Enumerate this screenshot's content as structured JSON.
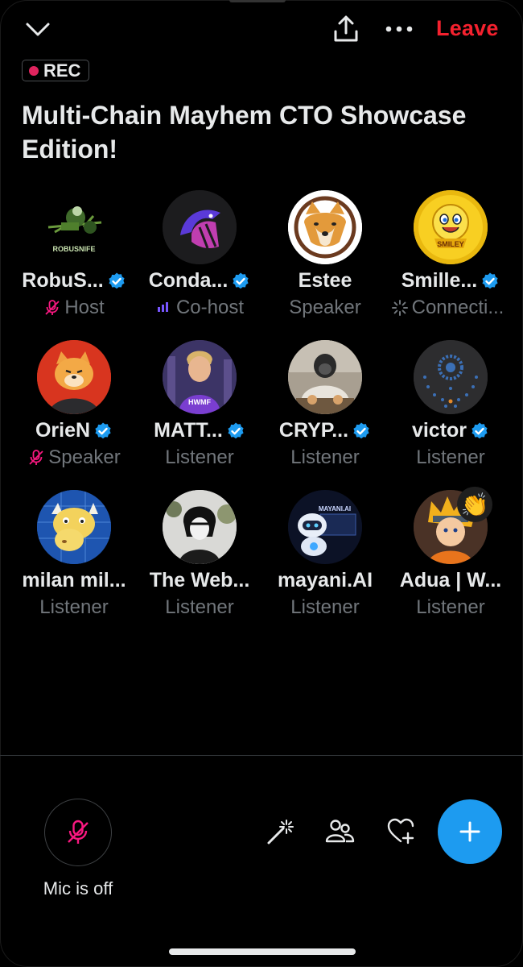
{
  "header": {
    "collapse_icon": "chevron-down-icon",
    "share_icon": "share-icon",
    "more_icon": "more-icon",
    "leave_label": "Leave",
    "rec_label": "REC",
    "title": "Multi-Chain Mayhem CTO Showcase Edition!"
  },
  "participants": [
    {
      "name": "RobuS...",
      "verified": true,
      "role": "Host",
      "role_icon": "mic-off-icon"
    },
    {
      "name": "Conda...",
      "verified": true,
      "role": "Co-host",
      "role_icon": "speaking-bars-icon"
    },
    {
      "name": "Estee",
      "verified": false,
      "role": "Speaker",
      "role_icon": ""
    },
    {
      "name": "Smille...",
      "verified": true,
      "role": "Connecti...",
      "role_icon": "loading-spinner-icon"
    },
    {
      "name": "OrieN",
      "verified": true,
      "role": "Speaker",
      "role_icon": "mic-off-icon"
    },
    {
      "name": "MATT...",
      "verified": true,
      "role": "Listener",
      "role_icon": ""
    },
    {
      "name": "CRYP...",
      "verified": true,
      "role": "Listener",
      "role_icon": ""
    },
    {
      "name": "victor",
      "verified": true,
      "role": "Listener",
      "role_icon": ""
    },
    {
      "name": "milan mil...",
      "verified": false,
      "role": "Listener",
      "role_icon": ""
    },
    {
      "name": "The Web...",
      "verified": false,
      "role": "Listener",
      "role_icon": ""
    },
    {
      "name": "mayani.AI",
      "verified": false,
      "role": "Listener",
      "role_icon": ""
    },
    {
      "name": "Adua | W...",
      "verified": false,
      "role": "Listener",
      "role_icon": "",
      "reaction": "👏"
    }
  ],
  "avatar_text": {
    "robusnife": "ROBUSNIFE",
    "smiley": "SMILEY",
    "hwmf": "HWMF",
    "mayani": "MAYANI.AI"
  },
  "controls": {
    "mic_label": "Mic is off",
    "mic_icon": "mic-off-icon",
    "tools": [
      "magic-wand-icon",
      "people-icon",
      "heart-plus-icon"
    ],
    "add_icon": "plus-icon"
  },
  "colors": {
    "background": "#000000",
    "leave": "#f4212e",
    "accent": "#1d9bf0",
    "rec_dot": "#e0245e",
    "muted_text": "#71767b",
    "mic_off": "#f91880",
    "cohost_bars": "#7856ff"
  }
}
